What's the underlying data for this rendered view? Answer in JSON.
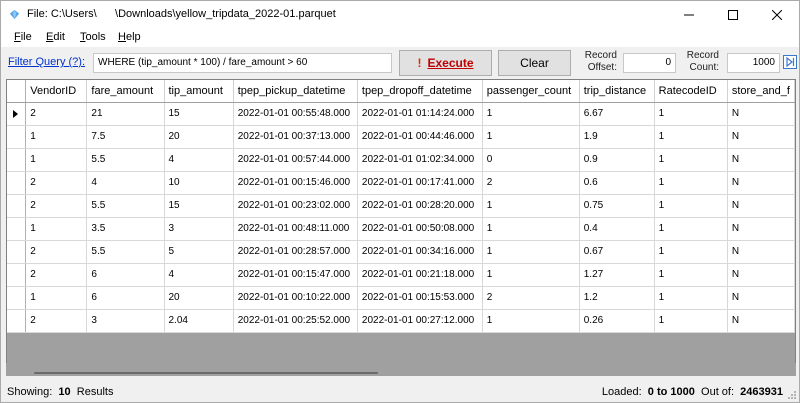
{
  "window": {
    "title": "File: C:\\Users\\      \\Downloads\\yellow_tripdata_2022-01.parquet"
  },
  "menu": {
    "file": {
      "pre": "",
      "key": "F",
      "post": "ile"
    },
    "edit": {
      "pre": "",
      "key": "E",
      "post": "dit"
    },
    "tools": {
      "pre": "",
      "key": "T",
      "post": "ools"
    },
    "help": {
      "pre": "",
      "key": "H",
      "post": "elp"
    }
  },
  "query": {
    "filter_label": "Filter Query (?):",
    "value": "WHERE (tip_amount * 100) / fare_amount > 60",
    "execute_label": "Execute",
    "execute_icon": "!",
    "clear_label": "Clear",
    "offset_label_1": "Record",
    "offset_label_2": "Offset:",
    "offset_value": "0",
    "count_label_1": "Record",
    "count_label_2": "Count:",
    "count_value": "1000"
  },
  "table": {
    "columns": [
      "VendorID",
      "fare_amount",
      "tip_amount",
      "tpep_pickup_datetime",
      "tpep_dropoff_datetime",
      "passenger_count",
      "trip_distance",
      "RatecodeID",
      "store_and_f"
    ],
    "rows": [
      [
        "2",
        "21",
        "15",
        "2022-01-01 00:55:48.000",
        "2022-01-01 01:14:24.000",
        "1",
        "6.67",
        "1",
        "N"
      ],
      [
        "1",
        "7.5",
        "20",
        "2022-01-01 00:37:13.000",
        "2022-01-01 00:44:46.000",
        "1",
        "1.9",
        "1",
        "N"
      ],
      [
        "1",
        "5.5",
        "4",
        "2022-01-01 00:57:44.000",
        "2022-01-01 01:02:34.000",
        "0",
        "0.9",
        "1",
        "N"
      ],
      [
        "2",
        "4",
        "10",
        "2022-01-01 00:15:46.000",
        "2022-01-01 00:17:41.000",
        "2",
        "0.6",
        "1",
        "N"
      ],
      [
        "2",
        "5.5",
        "15",
        "2022-01-01 00:23:02.000",
        "2022-01-01 00:28:20.000",
        "1",
        "0.75",
        "1",
        "N"
      ],
      [
        "1",
        "3.5",
        "3",
        "2022-01-01 00:48:11.000",
        "2022-01-01 00:50:08.000",
        "1",
        "0.4",
        "1",
        "N"
      ],
      [
        "2",
        "5.5",
        "5",
        "2022-01-01 00:28:57.000",
        "2022-01-01 00:34:16.000",
        "1",
        "0.67",
        "1",
        "N"
      ],
      [
        "2",
        "6",
        "4",
        "2022-01-01 00:15:47.000",
        "2022-01-01 00:21:18.000",
        "1",
        "1.27",
        "1",
        "N"
      ],
      [
        "1",
        "6",
        "20",
        "2022-01-01 00:10:22.000",
        "2022-01-01 00:15:53.000",
        "2",
        "1.2",
        "1",
        "N"
      ],
      [
        "2",
        "3",
        "2.04",
        "2022-01-01 00:25:52.000",
        "2022-01-01 00:27:12.000",
        "1",
        "0.26",
        "1",
        "N"
      ]
    ]
  },
  "status": {
    "showing_label": "Showing:",
    "showing_count": "10",
    "results_label": "Results",
    "loaded_label": "Loaded:",
    "loaded_range": "0 to 1000",
    "outof_label": "Out of:",
    "total": "2463931"
  },
  "icons": {
    "app": "diamond-icon",
    "minimize": "minimize-icon",
    "maximize": "maximize-icon",
    "close": "close-icon",
    "next": "next-page-icon",
    "row_pointer": "current-row-icon"
  },
  "colors": {
    "link": "#0033cc",
    "execute": "#c00000",
    "grid_background": "#a0a0a0",
    "app_icon": "#4fa3e6"
  }
}
